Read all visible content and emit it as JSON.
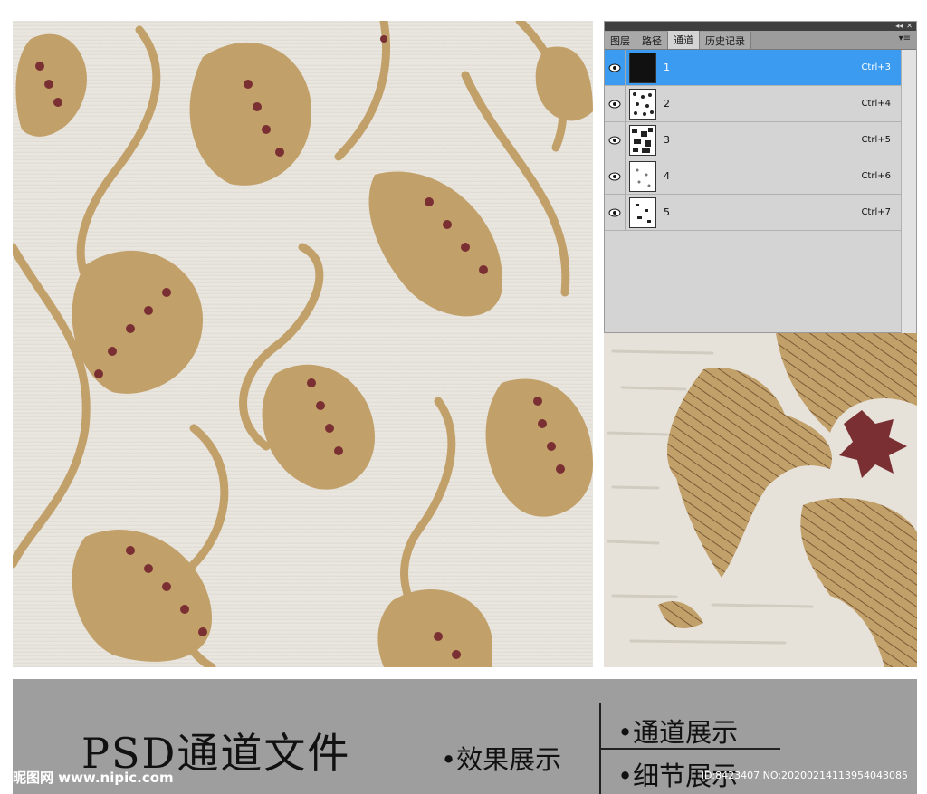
{
  "panel": {
    "tabs": [
      "图层",
      "路径",
      "通道",
      "历史记录"
    ],
    "active_tab": "通道",
    "collapse_glyph": "◂◂",
    "close_glyph": "✕",
    "menu_glyph": "▾≡",
    "channels": [
      {
        "name": "1",
        "shortcut": "Ctrl+3",
        "selected": true
      },
      {
        "name": "2",
        "shortcut": "Ctrl+4",
        "selected": false
      },
      {
        "name": "3",
        "shortcut": "Ctrl+5",
        "selected": false
      },
      {
        "name": "4",
        "shortcut": "Ctrl+6",
        "selected": false
      },
      {
        "name": "5",
        "shortcut": "Ctrl+7",
        "selected": false
      }
    ]
  },
  "footer": {
    "title": "PSD通道文件",
    "effect_label": "•效果展示",
    "channel_label": "•通道展示",
    "detail_label": "•细节展示",
    "watermark_logo": "昵图网 www.nipic.com",
    "watermark_id": "ID:8423407 NO:20200214113954043085"
  },
  "colors": {
    "background": "#e9e6df",
    "gold": "#c2a06a",
    "maroon": "#7a2f33",
    "selection": "#3a9bf0",
    "footer": "#9e9e9e"
  },
  "icons": {
    "visibility": "eye-icon",
    "close": "close-icon",
    "collapse": "collapse-icon",
    "menu": "panel-menu-icon"
  }
}
